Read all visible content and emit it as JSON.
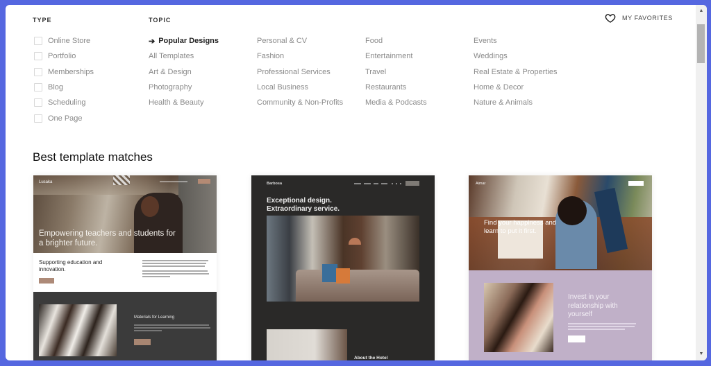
{
  "filters": {
    "type_label": "TYPE",
    "topic_label": "TOPIC",
    "types": [
      {
        "label": "Online Store",
        "checked": false
      },
      {
        "label": "Portfolio",
        "checked": false
      },
      {
        "label": "Memberships",
        "checked": false
      },
      {
        "label": "Blog",
        "checked": false
      },
      {
        "label": "Scheduling",
        "checked": false
      },
      {
        "label": "One Page",
        "checked": false
      }
    ],
    "topics": [
      [
        "Popular Designs",
        "All Templates",
        "Art & Design",
        "Photography",
        "Health & Beauty"
      ],
      [
        "Personal & CV",
        "Fashion",
        "Professional Services",
        "Local Business",
        "Community & Non-Profits"
      ],
      [
        "Food",
        "Entertainment",
        "Travel",
        "Restaurants",
        "Media & Podcasts"
      ],
      [
        "Events",
        "Weddings",
        "Real Estate & Properties",
        "Home & Decor",
        "Nature & Animals"
      ]
    ],
    "active_topic": "Popular Designs"
  },
  "favorites": {
    "label": "MY FAVORITES",
    "icon": "heart-icon"
  },
  "section_title": "Best template matches",
  "templates": [
    {
      "name": "Lusaka",
      "headline": "Empowering teachers and students for a brighter future.",
      "subheadline": "Supporting education and innovation.",
      "section_heading": "Materials for Learning",
      "accent": "#b48a74"
    },
    {
      "name": "Barbosa",
      "headline": "Exceptional design. Extraordinary service.",
      "section_heading": "About the Hotel",
      "accent": "#2a2928"
    },
    {
      "name": "Aimar",
      "headline": "Find your happiness and learn to put it first.",
      "section_heading": "Invest in your relationship with yourself",
      "accent": "#c0b0c8"
    }
  ],
  "colors": {
    "background": "#5567e0",
    "panel": "#ffffff"
  }
}
